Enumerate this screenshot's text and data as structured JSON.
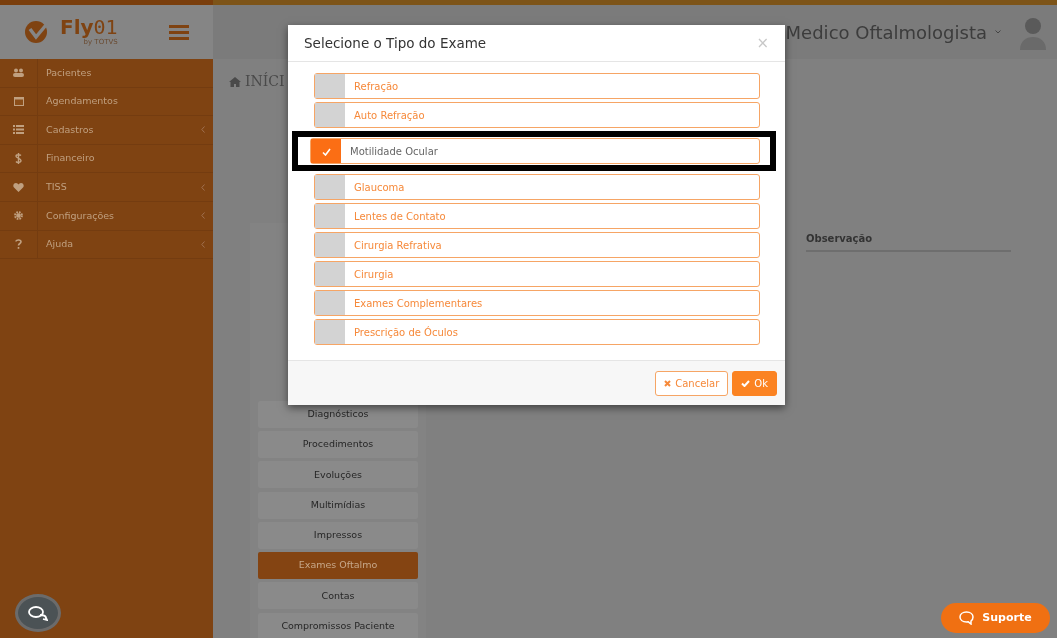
{
  "header": {
    "logo": "**Fly**01",
    "logo_sub": "by TOTVS",
    "user": "Medico Oftalmologista"
  },
  "sidebar": {
    "items": [
      {
        "label": "Pacientes",
        "has_submenu": false
      },
      {
        "label": "Agendamentos",
        "has_submenu": false
      },
      {
        "label": "Cadastros",
        "has_submenu": true
      },
      {
        "label": "Financeiro",
        "has_submenu": false
      },
      {
        "label": "TISS",
        "has_submenu": true
      },
      {
        "label": "Configurações",
        "has_submenu": true
      },
      {
        "label": "Ajuda",
        "has_submenu": true
      }
    ]
  },
  "breadcrumb": "INÍCI",
  "table": {
    "columns": [
      "Observação"
    ]
  },
  "tabs": [
    {
      "label": "Diagnósticos",
      "selected": false
    },
    {
      "label": "Procedimentos",
      "selected": false
    },
    {
      "label": "Evoluções",
      "selected": false
    },
    {
      "label": "Multimídias",
      "selected": false
    },
    {
      "label": "Impressos",
      "selected": false
    },
    {
      "label": "Exames Oftalmo",
      "selected": true
    },
    {
      "label": "Contas",
      "selected": false
    },
    {
      "label": "Compromissos Paciente",
      "selected": false
    }
  ],
  "modal": {
    "title": "Selecione o Tipo do Exame",
    "close": "×",
    "options": [
      {
        "label": "Refração",
        "checked": false,
        "highlighted": false
      },
      {
        "label": "Auto Refração",
        "checked": false,
        "highlighted": false
      },
      {
        "label": "Motilidade Ocular",
        "checked": true,
        "highlighted": true
      },
      {
        "label": "Glaucoma",
        "checked": false,
        "highlighted": false
      },
      {
        "label": "Lentes de Contato",
        "checked": false,
        "highlighted": false
      },
      {
        "label": "Cirurgia Refrativa",
        "checked": false,
        "highlighted": false
      },
      {
        "label": "Cirurgia",
        "checked": false,
        "highlighted": false
      },
      {
        "label": "Exames Complementares",
        "checked": false,
        "highlighted": false
      },
      {
        "label": "Prescrição de Óculos",
        "checked": false,
        "highlighted": false
      }
    ],
    "buttons": [
      {
        "kind": "cancel",
        "label": "Cancelar"
      },
      {
        "kind": "ok",
        "label": "Ok"
      }
    ]
  },
  "support_button": {
    "label": "Suporte"
  }
}
